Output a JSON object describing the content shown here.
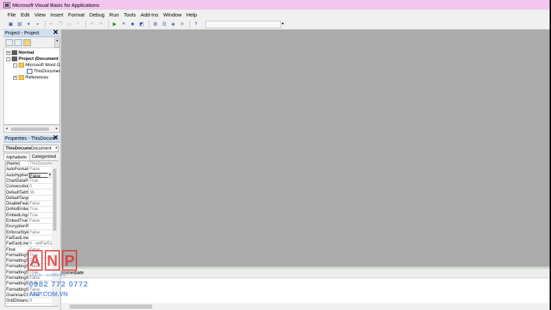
{
  "window": {
    "title": "Microsoft Visual Basic for Applications"
  },
  "menu": [
    "File",
    "Edit",
    "View",
    "Insert",
    "Format",
    "Debug",
    "Run",
    "Tools",
    "Add-Ins",
    "Window",
    "Help"
  ],
  "project_pane": {
    "title": "Project - Project",
    "tree": [
      {
        "label": "Normal",
        "bold": true,
        "expand": "+",
        "icon": "project-icon"
      },
      {
        "label": "Project (Document",
        "bold": true,
        "expand": "-",
        "icon": "project-icon"
      },
      {
        "label": "Microsoft Word Ol",
        "bold": false,
        "expand": "-",
        "icon": "folder-icon"
      },
      {
        "label": "ThisDocument",
        "bold": false,
        "expand": "",
        "icon": "word-document-icon"
      },
      {
        "label": "References",
        "bold": false,
        "expand": "+",
        "icon": "folder-icon"
      }
    ]
  },
  "properties_pane": {
    "title": "Properties - ThisDocum",
    "object_name": "ThisDocume",
    "object_type": "Document",
    "tabs": [
      "Alphabetic",
      "Categorized"
    ],
    "active_tab": "Alphabetic",
    "rows": [
      {
        "name": "(Name)",
        "value": "ThisDocume"
      },
      {
        "name": "AutoFormatC",
        "value": "False"
      },
      {
        "name": "AutoHyphena",
        "value": "False"
      },
      {
        "name": "ChartDataPoi",
        "value": "True"
      },
      {
        "name": "ConsecutiveH",
        "value": "0"
      },
      {
        "name": "DefaultTabSt",
        "value": "36"
      },
      {
        "name": "DefaultTarge",
        "value": ""
      },
      {
        "name": "DisableFeatu",
        "value": "False"
      },
      {
        "name": "DoNotEmbed",
        "value": "True"
      },
      {
        "name": "EmbedLinguis",
        "value": "True"
      },
      {
        "name": "EmbedTrueTy",
        "value": "False"
      },
      {
        "name": "EncryptionPro",
        "value": ""
      },
      {
        "name": "EnforceStyle",
        "value": "False"
      },
      {
        "name": "FarEastLineB",
        "value": ""
      },
      {
        "name": "FarEastLineB",
        "value": "0 - wdFarEa"
      },
      {
        "name": "Final",
        "value": "False"
      },
      {
        "name": "FormattingSh",
        "value": "True"
      },
      {
        "name": "FormattingSh",
        "value": "True"
      },
      {
        "name": "FormattingSh",
        "value": "False"
      },
      {
        "name": "FormattingSh",
        "value": "True"
      },
      {
        "name": "FormattingSh",
        "value": "False"
      },
      {
        "name": "FormattingSh",
        "value": "True"
      },
      {
        "name": "FormattingSh",
        "value": "False"
      },
      {
        "name": "GrammarChec",
        "value": "False"
      },
      {
        "name": "GridDistanceH",
        "value": "9"
      }
    ]
  },
  "immediate": {
    "title": "Immediate"
  },
  "watermark": {
    "letters": [
      "A",
      "N",
      "P"
    ],
    "tagline": "TECH - CAMERA",
    "phone": "0982 772 0772",
    "site": "ANP.COM.VN"
  }
}
